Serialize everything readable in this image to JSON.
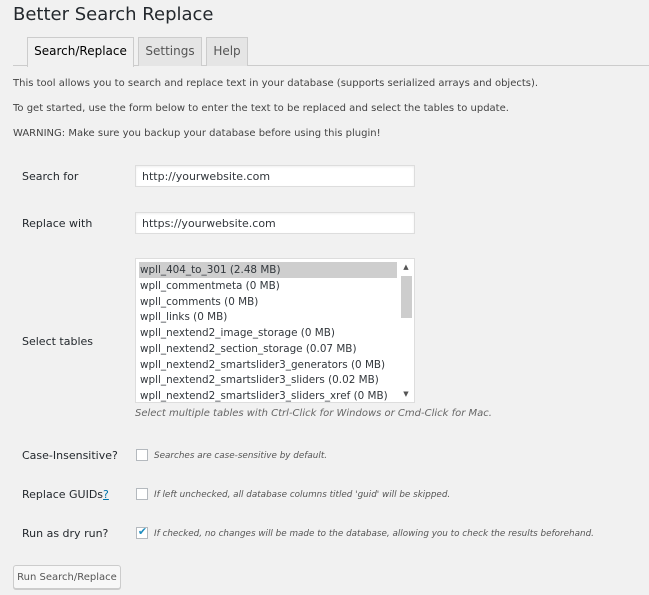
{
  "title": "Better Search Replace",
  "tabs": [
    {
      "label": "Search/Replace",
      "active": true
    },
    {
      "label": "Settings",
      "active": false
    },
    {
      "label": "Help",
      "active": false
    }
  ],
  "intro": [
    "This tool allows you to search and replace text in your database (supports serialized arrays and objects).",
    "To get started, use the form below to enter the text to be replaced and select the tables to update.",
    "WARNING: Make sure you backup your database before using this plugin!"
  ],
  "search": {
    "label": "Search for",
    "value": "http://yourwebsite.com"
  },
  "replace": {
    "label": "Replace with",
    "value": "https://yourwebsite.com"
  },
  "tables": {
    "label": "Select tables",
    "options": [
      "wpll_404_to_301 (2.48 MB)",
      "wpll_commentmeta (0 MB)",
      "wpll_comments (0 MB)",
      "wpll_links (0 MB)",
      "wpll_nextend2_image_storage (0 MB)",
      "wpll_nextend2_section_storage (0.07 MB)",
      "wpll_nextend2_smartslider3_generators (0 MB)",
      "wpll_nextend2_smartslider3_sliders (0.02 MB)",
      "wpll_nextend2_smartslider3_sliders_xref (0 MB)"
    ],
    "selected_index": 0,
    "hint": "Select multiple tables with Ctrl-Click for Windows or Cmd-Click for Mac.",
    "scroll_up_glyph": "▲",
    "scroll_down_glyph": "▼"
  },
  "case_insensitive": {
    "label": "Case-Insensitive?",
    "checked": false,
    "description": "Searches are case-sensitive by default."
  },
  "replace_guids": {
    "label": "Replace GUIDs",
    "help_link": "?",
    "checked": false,
    "description": "If left unchecked, all database columns titled 'guid' will be skipped."
  },
  "dry_run": {
    "label": "Run as dry run?",
    "checked": true,
    "checkmark": "✔",
    "description": "If checked, no changes will be made to the database, allowing you to check the results beforehand."
  },
  "run_button": "Run Search/Replace",
  "colors": {
    "background": "#f1f1f1",
    "link": "#0073aa",
    "checkmark": "#1e8cbe",
    "selected_option": "#cecece"
  }
}
